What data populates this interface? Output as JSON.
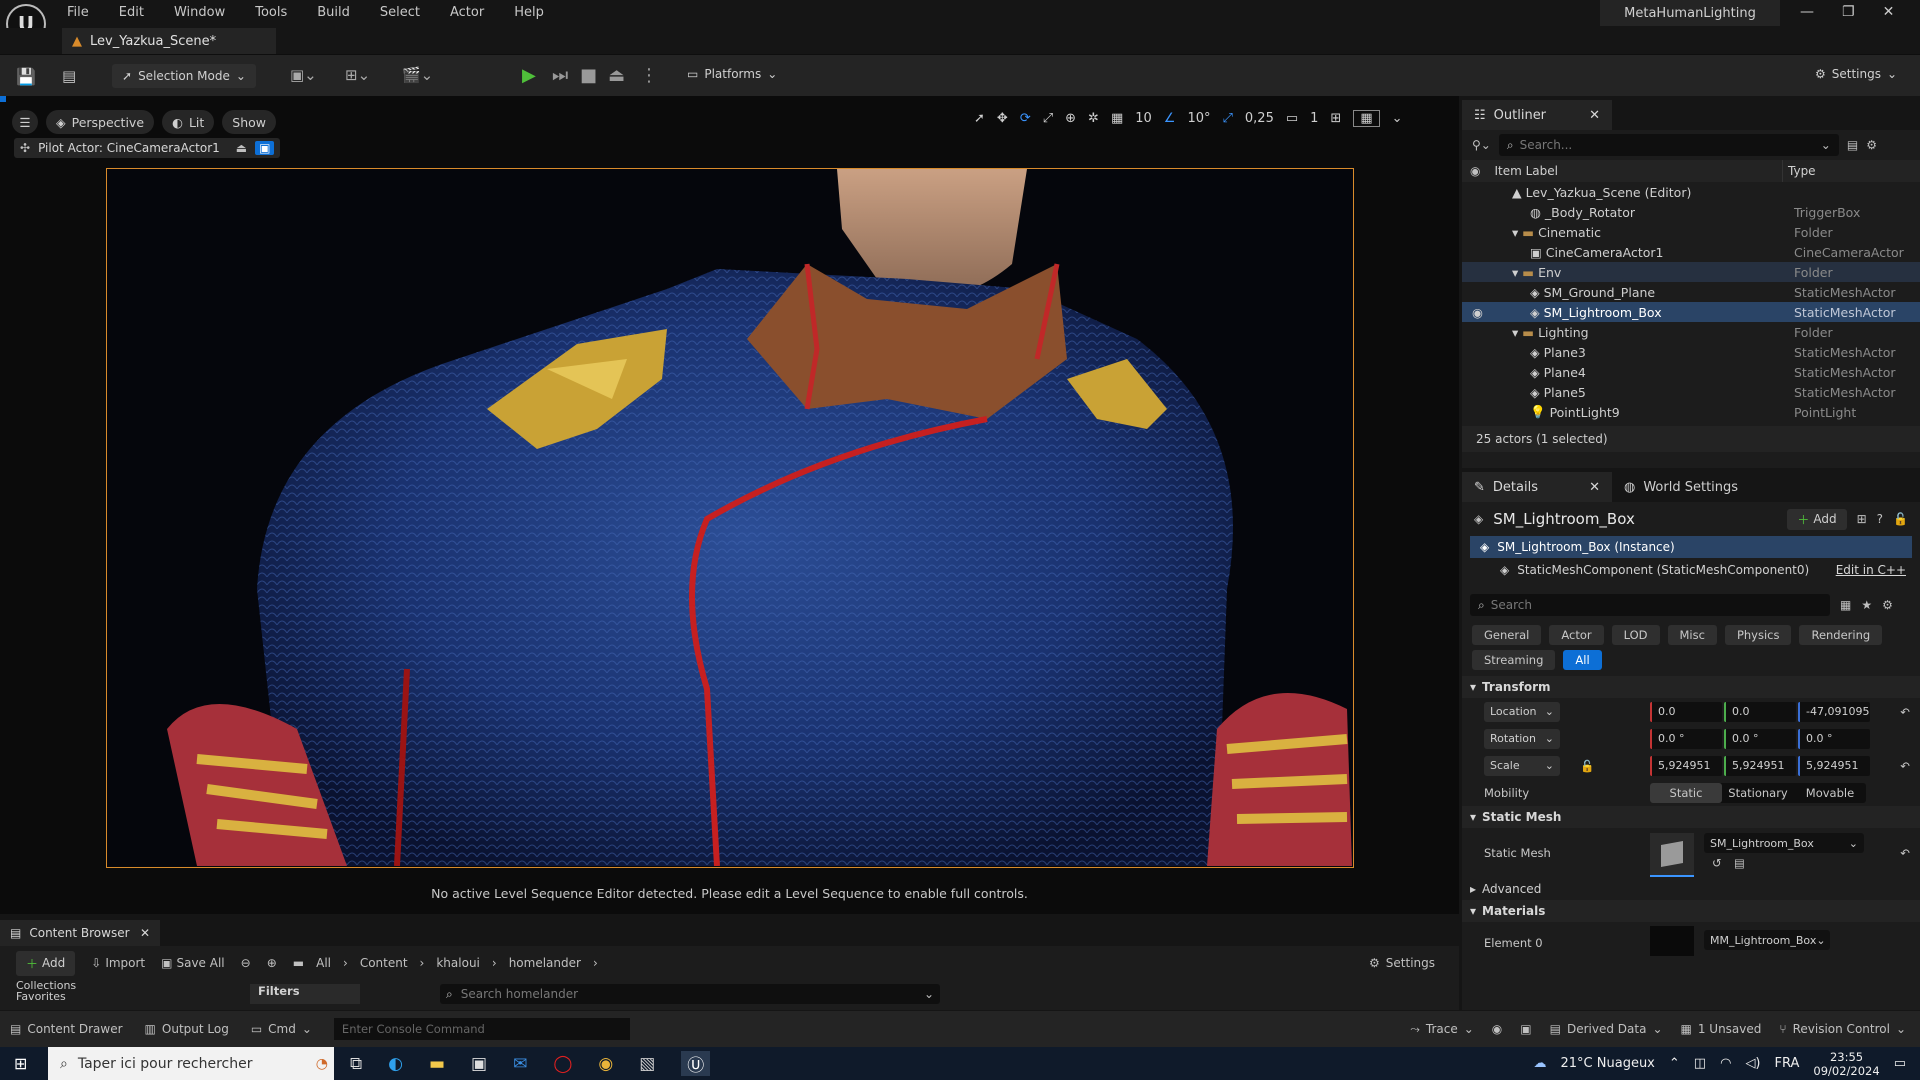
{
  "app": {
    "project_name": "MetaHumanLighting",
    "level_tab": "Lev_Yazkua_Scene*",
    "menu": [
      "File",
      "Edit",
      "Window",
      "Tools",
      "Build",
      "Select",
      "Actor",
      "Help"
    ]
  },
  "toolbar": {
    "selection_mode": "Selection Mode",
    "platforms": "Platforms",
    "settings": "Settings"
  },
  "viewport": {
    "perspective": "Perspective",
    "lit": "Lit",
    "show": "Show",
    "pilot_actor": "Pilot Actor: CineCameraActor1",
    "grid_snap": "10",
    "rotation_snap": "10°",
    "scale_snap": "0,25",
    "camera_speed": "1",
    "notice": "No active Level Sequence Editor detected. Please edit a Level Sequence to enable full controls."
  },
  "outliner": {
    "title": "Outliner",
    "search_placeholder": "Search...",
    "col_label": "Item Label",
    "col_type": "Type",
    "rows": [
      {
        "label": "Lev_Yazkua_Scene (Editor)",
        "type": ""
      },
      {
        "label": "_Body_Rotator",
        "type": "TriggerBox"
      },
      {
        "label": "Cinematic",
        "type": "Folder"
      },
      {
        "label": "CineCameraActor1",
        "type": "CineCameraActor"
      },
      {
        "label": "Env",
        "type": "Folder"
      },
      {
        "label": "SM_Ground_Plane",
        "type": "StaticMeshActor"
      },
      {
        "label": "SM_Lightroom_Box",
        "type": "StaticMeshActor"
      },
      {
        "label": "Lighting",
        "type": "Folder"
      },
      {
        "label": "Plane3",
        "type": "StaticMeshActor"
      },
      {
        "label": "Plane4",
        "type": "StaticMeshActor"
      },
      {
        "label": "Plane5",
        "type": "StaticMeshActor"
      },
      {
        "label": "PointLight9",
        "type": "PointLight"
      }
    ],
    "count": "25 actors (1 selected)"
  },
  "details": {
    "title": "Details",
    "world_settings": "World Settings",
    "actor_name": "SM_Lightroom_Box",
    "add": "Add",
    "instance": "SM_Lightroom_Box (Instance)",
    "component": "StaticMeshComponent (StaticMeshComponent0)",
    "edit_cpp": "Edit in C++",
    "search_placeholder": "Search",
    "chips": [
      "General",
      "Actor",
      "LOD",
      "Misc",
      "Physics",
      "Rendering",
      "Streaming",
      "All"
    ],
    "transform": "Transform",
    "location": {
      "label": "Location",
      "x": "0.0",
      "y": "0.0",
      "z": "-47,091095"
    },
    "rotation": {
      "label": "Rotation",
      "x": "0.0 °",
      "y": "0.0 °",
      "z": "0.0 °"
    },
    "scale": {
      "label": "Scale",
      "x": "5,924951",
      "y": "5,924951",
      "z": "5,924951"
    },
    "mobility": {
      "label": "Mobility",
      "opts": [
        "Static",
        "Stationary",
        "Movable"
      ]
    },
    "static_mesh_section": "Static Mesh",
    "static_mesh_label": "Static Mesh",
    "static_mesh_value": "SM_Lightroom_Box",
    "advanced": "Advanced",
    "materials": "Materials",
    "element0": "Element 0",
    "material_value": "MM_Lightroom_Box"
  },
  "content_browser": {
    "title": "Content Browser",
    "add": "Add",
    "import": "Import",
    "save_all": "Save All",
    "path": [
      "All",
      "Content",
      "khaloui",
      "homelander"
    ],
    "settings": "Settings",
    "collections": "Collections",
    "favorites": "Favorites",
    "filters": "Filters",
    "search_placeholder": "Search homelander"
  },
  "statusbar": {
    "content_drawer": "Content Drawer",
    "output_log": "Output Log",
    "cmd": "Cmd",
    "console_placeholder": "Enter Console Command",
    "trace": "Trace",
    "derived_data": "Derived Data",
    "unsaved": "1 Unsaved",
    "revision_control": "Revision Control"
  },
  "taskbar": {
    "search_placeholder": "Taper ici pour rechercher",
    "weather": "21°C  Nuageux",
    "lang": "FRA",
    "time": "23:55",
    "date": "09/02/2024"
  },
  "colors": {
    "accent": "#0d6fd6",
    "selection": "#2a4466",
    "frame": "#d98b2b",
    "suit": "#1f3a78"
  }
}
